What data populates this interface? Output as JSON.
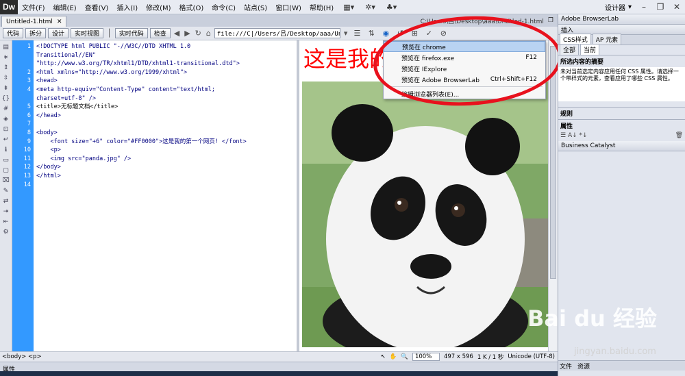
{
  "app": {
    "logo": "Dw"
  },
  "menu": [
    "文件(F)",
    "编辑(E)",
    "查看(V)",
    "插入(I)",
    "修改(M)",
    "格式(O)",
    "命令(C)",
    "站点(S)",
    "窗口(W)",
    "帮助(H)"
  ],
  "menu_right": {
    "designer": "设计器"
  },
  "document": {
    "tab": "Untitled-1.html",
    "path": "C:\\Users\\吕\\Desktop\\aaa\\Untitled-1.html"
  },
  "toolbar": {
    "code": "代码",
    "split": "拆分",
    "design": "设计",
    "live_view": "实时视图",
    "live_code": "实时代码",
    "inspect": "检查",
    "address": "file:///C|/Users/吕/Desktop/aaa/Untitl"
  },
  "line_numbers": [
    "1",
    "2",
    "3",
    "4",
    "5",
    "6",
    "7",
    "8",
    "9",
    "10",
    "11",
    "12",
    "13",
    "14"
  ],
  "code_lines": [
    "<!DOCTYPE html PUBLIC \"-//W3C//DTD XHTML 1.0",
    "Transitional//EN\"",
    "\"http://www.w3.org/TR/xhtml1/DTD/xhtml1-transitional.dtd\">",
    "<html xmlns=\"http://www.w3.org/1999/xhtml\">",
    "<head>",
    "<meta http-equiv=\"Content-Type\" content=\"text/html;",
    "charset=utf-8\" />",
    "<title>无标题文档</title>",
    "</head>",
    "",
    "<body>",
    "    <font size=\"+6\" color=\"#FF0000\">这是我的第一个网页! </font>",
    "    <p>",
    "    <img src=\"panda.jpg\" />",
    "</body>",
    "</html>"
  ],
  "design_view": {
    "heading": "这是我的"
  },
  "browser_menu": {
    "items": [
      {
        "label": "预览在 chrome",
        "shortcut": ""
      },
      {
        "label": "预览在 firefox.exe",
        "shortcut": "F12"
      },
      {
        "label": "预览在 IExplore",
        "shortcut": ""
      },
      {
        "label": "预览在 Adobe BrowserLab",
        "shortcut": "Ctrl+Shift+F12"
      }
    ],
    "edit_list": "编辑浏览器列表(E)..."
  },
  "status": {
    "tags": "<body> <p>",
    "zoom": "100%",
    "size": "497 x 596",
    "download": "1 K / 1 秒",
    "encoding": "Unicode (UTF-8)"
  },
  "properties": {
    "title": "属性"
  },
  "right_panel": {
    "browserlab": "Adobe BrowserLab",
    "insert": "插入",
    "css_tab": "CSS样式",
    "ap_tab": "AP 元素",
    "all": "全部",
    "current": "当前",
    "summary_title": "所选内容的摘要",
    "summary_text": "未对当前选定内容应用任何 CSS 属性。请选择一个带样式的元素，查看应用了哪些 CSS 属性。",
    "rules": "规则",
    "props": "属性",
    "bc": "Business Catalyst",
    "files": "文件",
    "assets": "资源"
  },
  "watermark": {
    "main": "Bai du 经验",
    "sub": "jingyan.baidu.com"
  },
  "colors": {
    "gutter": "#3399ff",
    "heading_red": "#ff0000",
    "annotation": "#e8111d"
  }
}
